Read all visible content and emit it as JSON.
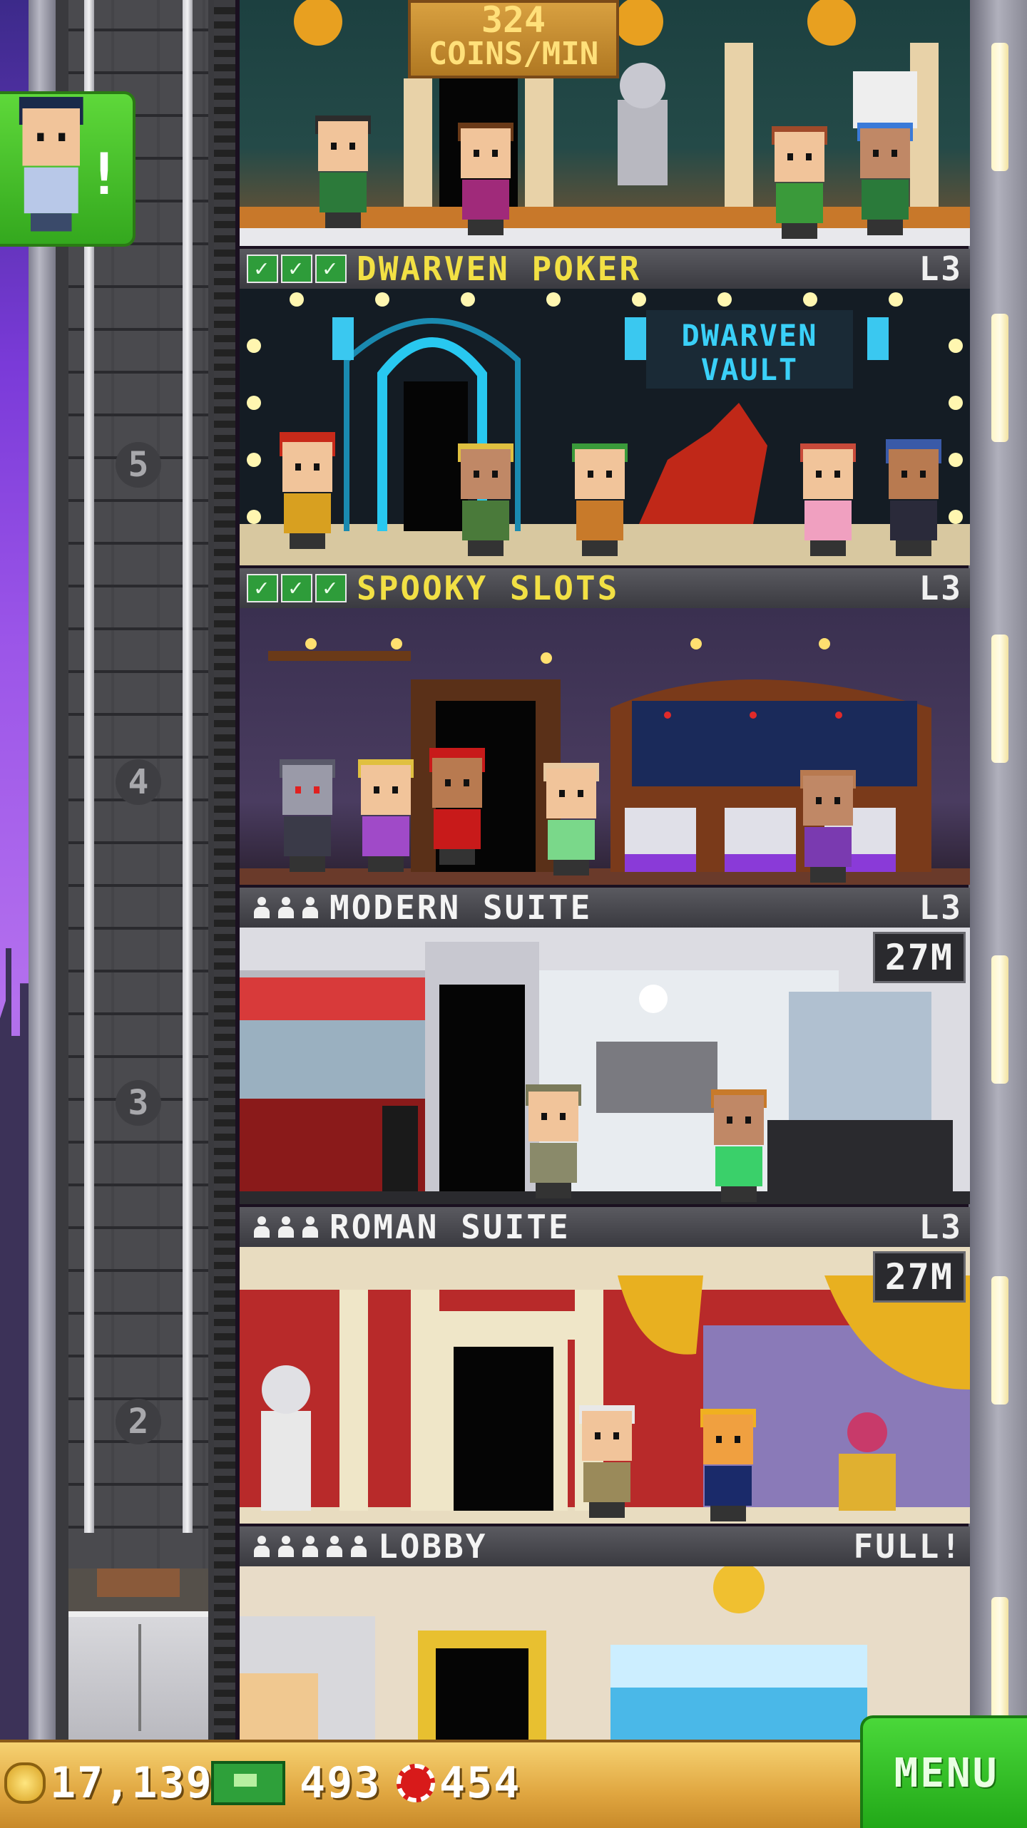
{
  "top_banner": {
    "value": "324",
    "unit": "COINS/MIN"
  },
  "notification": {
    "badge": "!"
  },
  "shaft_floors": [
    "5",
    "4",
    "3",
    "2"
  ],
  "floors": [
    {
      "name": "DWARVEN POKER",
      "level": "L3",
      "checks": 3,
      "sign": "DWARVEN VAULT"
    },
    {
      "name": "SPOOKY SLOTS",
      "level": "L3",
      "checks": 3
    },
    {
      "name": "MODERN SUITE",
      "level": "L3",
      "occupants": 3,
      "price": "27M"
    },
    {
      "name": "ROMAN SUITE",
      "level": "L3",
      "occupants": 3,
      "price": "27M"
    },
    {
      "name": "LOBBY",
      "level": "FULL!",
      "occupants": 5
    }
  ],
  "bottom_bar": {
    "coins": "17,139",
    "bux": "493",
    "chips": "454",
    "menu_label": "MENU"
  },
  "colors": {
    "gold_text": "#f2e044",
    "menu_green": "#34c020",
    "bar_gold": "#e0a640"
  }
}
